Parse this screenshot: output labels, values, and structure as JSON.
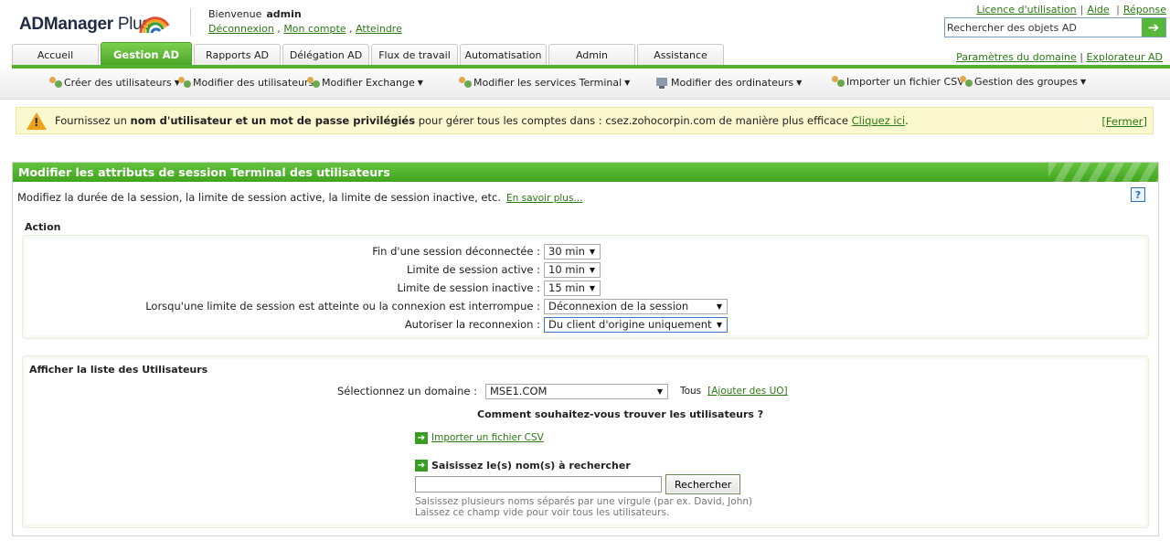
{
  "header": {
    "logo_main": "ADManager",
    "logo_plus": " Plus",
    "welcome": "Bienvenue",
    "user": "admin",
    "links": [
      "Déconnexion",
      "Mon compte",
      "Atteindre"
    ],
    "top_links": [
      "Licence d'utilisation",
      "Aide",
      "Réponse"
    ],
    "search_value": "Rechercher des objets AD"
  },
  "tabs": [
    {
      "label": "Accueil",
      "active": false
    },
    {
      "label": "Gestion AD",
      "active": true
    },
    {
      "label": "Rapports AD",
      "active": false
    },
    {
      "label": "Délégation AD",
      "active": false
    },
    {
      "label": "Flux de travail",
      "active": false
    },
    {
      "label": "Automatisation",
      "active": false
    },
    {
      "label": "Admin",
      "active": false
    },
    {
      "label": "Assistance",
      "active": false
    }
  ],
  "right_links": [
    "Paramètres du domaine",
    "Explorateur AD"
  ],
  "toolbar": [
    "Créer des utilisateurs",
    "Modifier des utilisateurs",
    "Modifier Exchange",
    "Modifier les services Terminal",
    "Modifier des ordinateurs",
    "Importer un fichier CSV",
    "Gestion des groupes"
  ],
  "notice": {
    "pre": "Fournissez un ",
    "bold": "nom d'utilisateur et un mot de passe privilégiés",
    "post": " pour gérer tous les comptes dans : csez.zohocorpin.com de manière plus efficace ",
    "link": "Cliquez ici",
    "end": ".",
    "close": "[Fermer]"
  },
  "panel": {
    "title": "Modifier les attributs de session Terminal des utilisateurs",
    "desc": "Modifiez la durée de la session, la limite de session active, la limite de session inactive, etc.",
    "learn_more": "En savoir plus...",
    "help": "?"
  },
  "action": {
    "label": "Action",
    "rows": [
      {
        "label": "Fin d'une session déconnectée :",
        "value": "30 min"
      },
      {
        "label": "Limite de session active :",
        "value": "10 min"
      },
      {
        "label": "Limite de session inactive :",
        "value": "15 min"
      },
      {
        "label": "Lorsqu'une limite de session est atteinte ou la connexion est interrompue :",
        "value": "Déconnexion de la session"
      },
      {
        "label": "Autoriser la reconnexion :",
        "value": "Du client d'origine uniquement"
      }
    ]
  },
  "users": {
    "label": "Afficher la liste des Utilisateurs",
    "domain_label": "Sélectionnez un domaine :",
    "domain_value": "MSE1.COM",
    "all": "Tous",
    "add_ou": "[Ajouter des UO]",
    "question": "Comment souhaitez-vous trouver les utilisateurs ?",
    "import_csv": "Importer un fichier CSV",
    "enter_names": "Saisissez le(s) nom(s) à rechercher",
    "search_btn": "Rechercher",
    "hint1": "Saisissez plusieurs noms séparés par une virgule (par ex. David, John)",
    "hint2": "Laissez ce champ vide pour voir tous les utilisateurs."
  }
}
